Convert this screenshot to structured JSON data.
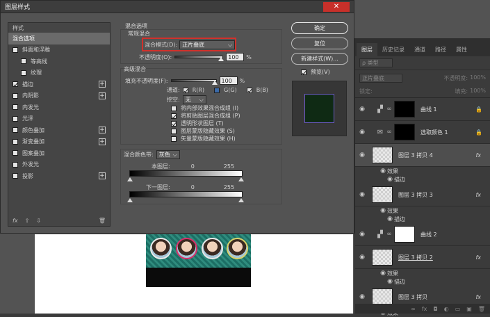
{
  "dialog": {
    "title": "图层样式",
    "close_label": "✕",
    "styles_header": "样式",
    "styles": [
      {
        "label": "混合选项",
        "checkbox": false,
        "checked": false,
        "plus": false,
        "indent": false,
        "selected": true
      },
      {
        "label": "斜面和浮雕",
        "checkbox": true,
        "checked": false,
        "plus": false,
        "indent": false
      },
      {
        "label": "等高线",
        "checkbox": true,
        "checked": false,
        "plus": false,
        "indent": true
      },
      {
        "label": "纹理",
        "checkbox": true,
        "checked": false,
        "plus": false,
        "indent": true
      },
      {
        "label": "描边",
        "checkbox": true,
        "checked": true,
        "plus": true,
        "indent": false
      },
      {
        "label": "内阴影",
        "checkbox": true,
        "checked": false,
        "plus": true,
        "indent": false
      },
      {
        "label": "内发光",
        "checkbox": true,
        "checked": false,
        "plus": false,
        "indent": false
      },
      {
        "label": "光泽",
        "checkbox": true,
        "checked": false,
        "plus": false,
        "indent": false
      },
      {
        "label": "颜色叠加",
        "checkbox": true,
        "checked": false,
        "plus": true,
        "indent": false
      },
      {
        "label": "渐变叠加",
        "checkbox": true,
        "checked": false,
        "plus": true,
        "indent": false
      },
      {
        "label": "图案叠加",
        "checkbox": true,
        "checked": false,
        "plus": false,
        "indent": false
      },
      {
        "label": "外发光",
        "checkbox": true,
        "checked": false,
        "plus": false,
        "indent": false
      },
      {
        "label": "投影",
        "checkbox": true,
        "checked": false,
        "plus": true,
        "indent": false
      }
    ],
    "footer": {
      "fx": "fx",
      "up": "⇧",
      "down": "⇩",
      "trash": "🗑"
    },
    "blend": {
      "section_title": "混合选项",
      "general_title": "常规混合",
      "mode_label": "混合模式(D):",
      "mode_value": "正片叠底",
      "opacity_label": "不透明度(O):",
      "opacity_value": "100",
      "percent": "%",
      "advanced_title": "高级混合",
      "fill_label": "填充不透明度(F):",
      "fill_value": "100",
      "channels_label": "通道:",
      "channel_r": "R(R)",
      "channel_g": "G(G)",
      "channel_b": "B(B)",
      "knockout_label": "挖空:",
      "knockout_value": "无",
      "opt1": "将内部效果混合成组 (I)",
      "opt2": "将剪贴图层混合成组 (P)",
      "opt3": "透明形状图层 (T)",
      "opt4": "图层蒙版隐藏效果 (S)",
      "opt5": "矢量蒙版隐藏效果 (H)",
      "blendif_label": "混合颜色带:",
      "blendif_value": "灰色",
      "this_layer": "本图层:",
      "this_min": "0",
      "this_max": "255",
      "under_layer": "下一图层:",
      "under_min": "0",
      "under_max": "255"
    },
    "buttons": {
      "ok": "确定",
      "reset": "复位",
      "new_style": "新建样式(W)...",
      "preview": "预览(V)"
    }
  },
  "layers": {
    "tabs": [
      "图层",
      "历史记录",
      "通道",
      "路径",
      "属性"
    ],
    "filter_placeholder": "ρ 类型",
    "blend_mode": "正片叠底",
    "opacity_label": "不透明度:",
    "opacity_value": "100%",
    "lock_label": "锁定:",
    "fill_label": "填充:",
    "fill_value": "100%",
    "items": [
      {
        "name": "曲线 1",
        "thumb": "black",
        "adj": "▞",
        "fx": "",
        "lock": "🔒"
      },
      {
        "name": "选取颜色 1",
        "thumb": "black",
        "adj": "✉",
        "fx": "",
        "lock": "🔒"
      },
      {
        "name": "图层 3 拷贝 4",
        "thumb": "checker",
        "adj": "",
        "fx": "fx",
        "lock": ""
      },
      {
        "name": "图层 3 拷贝 3",
        "thumb": "checker",
        "adj": "",
        "fx": "fx",
        "lock": ""
      },
      {
        "name": "曲线 2",
        "thumb": "white",
        "adj": "▞",
        "fx": "",
        "lock": ""
      },
      {
        "name": "图层 3 拷贝 2",
        "thumb": "checker",
        "adj": "",
        "fx": "fx",
        "lock": ""
      },
      {
        "name": "图层 3 拷贝",
        "thumb": "checker",
        "adj": "",
        "fx": "fx",
        "lock": ""
      }
    ],
    "effects_label": "效果",
    "stroke_label": "描边",
    "footer_icons": [
      "∞",
      "fx",
      "◘",
      "◐",
      "▭",
      "▣",
      "🗑"
    ]
  }
}
